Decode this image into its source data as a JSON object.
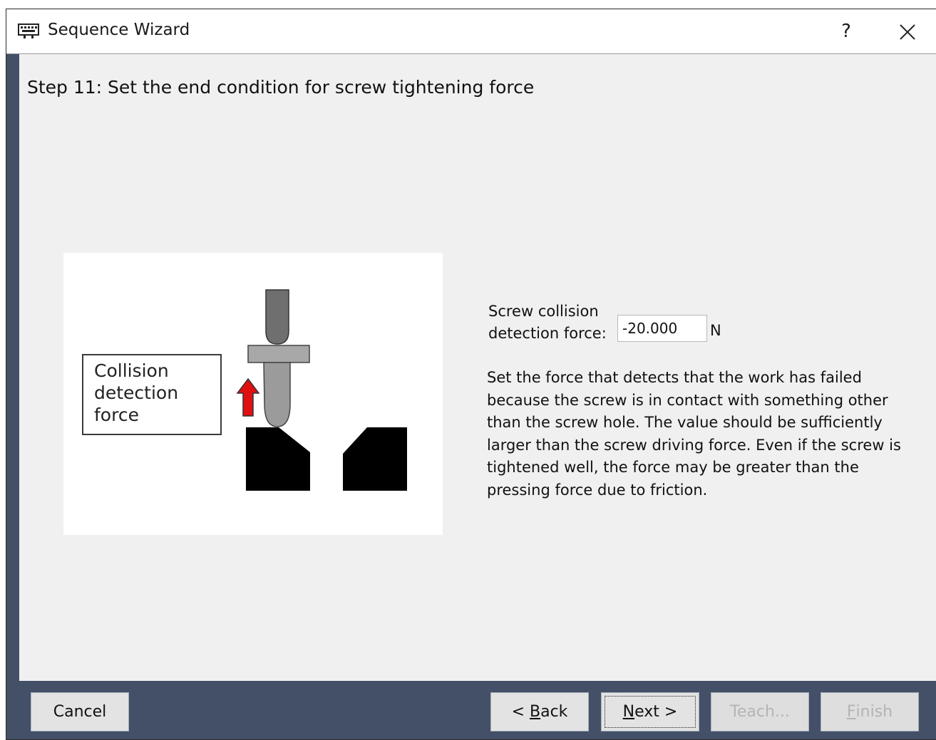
{
  "window": {
    "title": "Sequence Wizard",
    "help_label": "?",
    "app_icon": "wizard-icon",
    "close_icon": "close-icon"
  },
  "step": {
    "heading": "Step 11: Set the end condition for screw tightening force"
  },
  "illustration": {
    "label": "Collision\ndetection\nforce",
    "arrow_color": "#e01010"
  },
  "form": {
    "field_label": "Screw collision\ndetection force:",
    "value": "-20.000",
    "unit": "N",
    "description": "Set the force that detects that the work has failed\nbecause the screw is in contact with something other\nthan the screw hole. The value should be sufficiently\nlarger than the screw driving force. Even if the screw is\ntightened well, the force may be greater than the\npressing force due to friction."
  },
  "buttons": {
    "cancel": "Cancel",
    "back_prefix": "< ",
    "back_mnemonic": "B",
    "back_rest": "ack",
    "next_mnemonic": "N",
    "next_rest": "ext >",
    "teach": "Teach...",
    "finish_mnemonic": "F",
    "finish_rest": "inish"
  },
  "colors": {
    "frame": "#435068",
    "content": "#f0f0f0",
    "disabled_text": "#b4b4b4"
  }
}
